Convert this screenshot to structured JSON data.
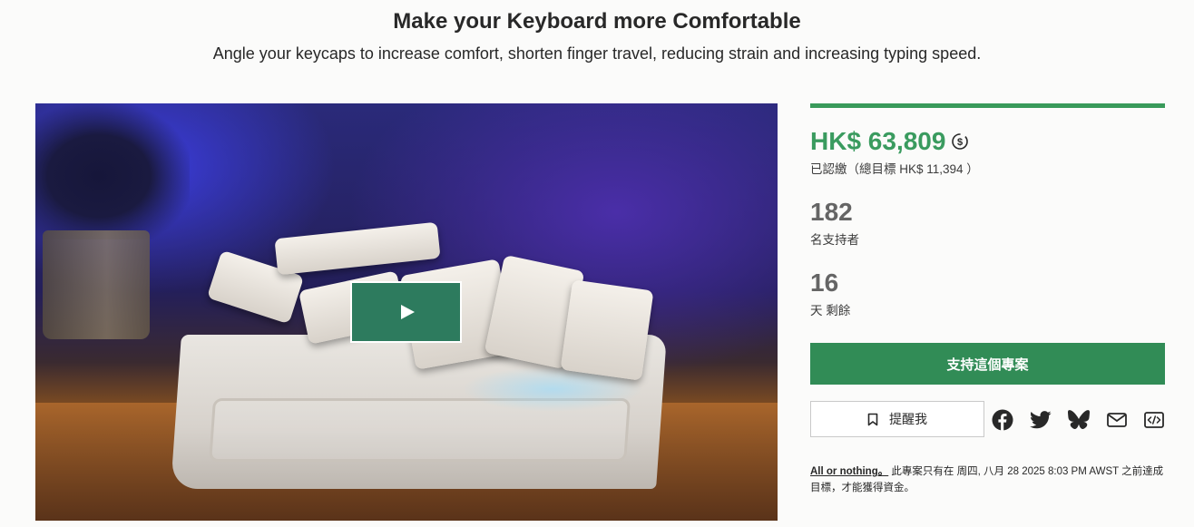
{
  "header": {
    "title": "Make your Keyboard more Comfortable",
    "subtitle": "Angle your keycaps to increase comfort, shorten finger travel, reducing strain and increasing typing speed."
  },
  "video": {
    "play_icon": "play-icon",
    "thumbnail": "keyboard-keycaps-photo"
  },
  "funding": {
    "progress_fraction": 1.0,
    "pledged": "HK$ 63,809",
    "currency_icon": "currency-convert-icon",
    "goal_text": "已認繳（總目標 HK$ 11,394 ）"
  },
  "stats": {
    "backers_count": "182",
    "backers_label": "名支持者",
    "days_count": "16",
    "days_label": "天 剩餘"
  },
  "actions": {
    "back_label": "支持這個專案",
    "remind_label": "提醒我",
    "share_icons": [
      "facebook-icon",
      "twitter-icon",
      "bluesky-icon",
      "email-icon",
      "embed-icon"
    ]
  },
  "note": {
    "link": "All or nothing。",
    "text": " 此專案只有在 周四, 八月 28 2025 8:03 PM AWST 之前達成目標，才能獲得資金。"
  },
  "colors": {
    "accent_green": "#3a9b5f",
    "button_green": "#318c56",
    "play_button": "#2d7b5e"
  }
}
